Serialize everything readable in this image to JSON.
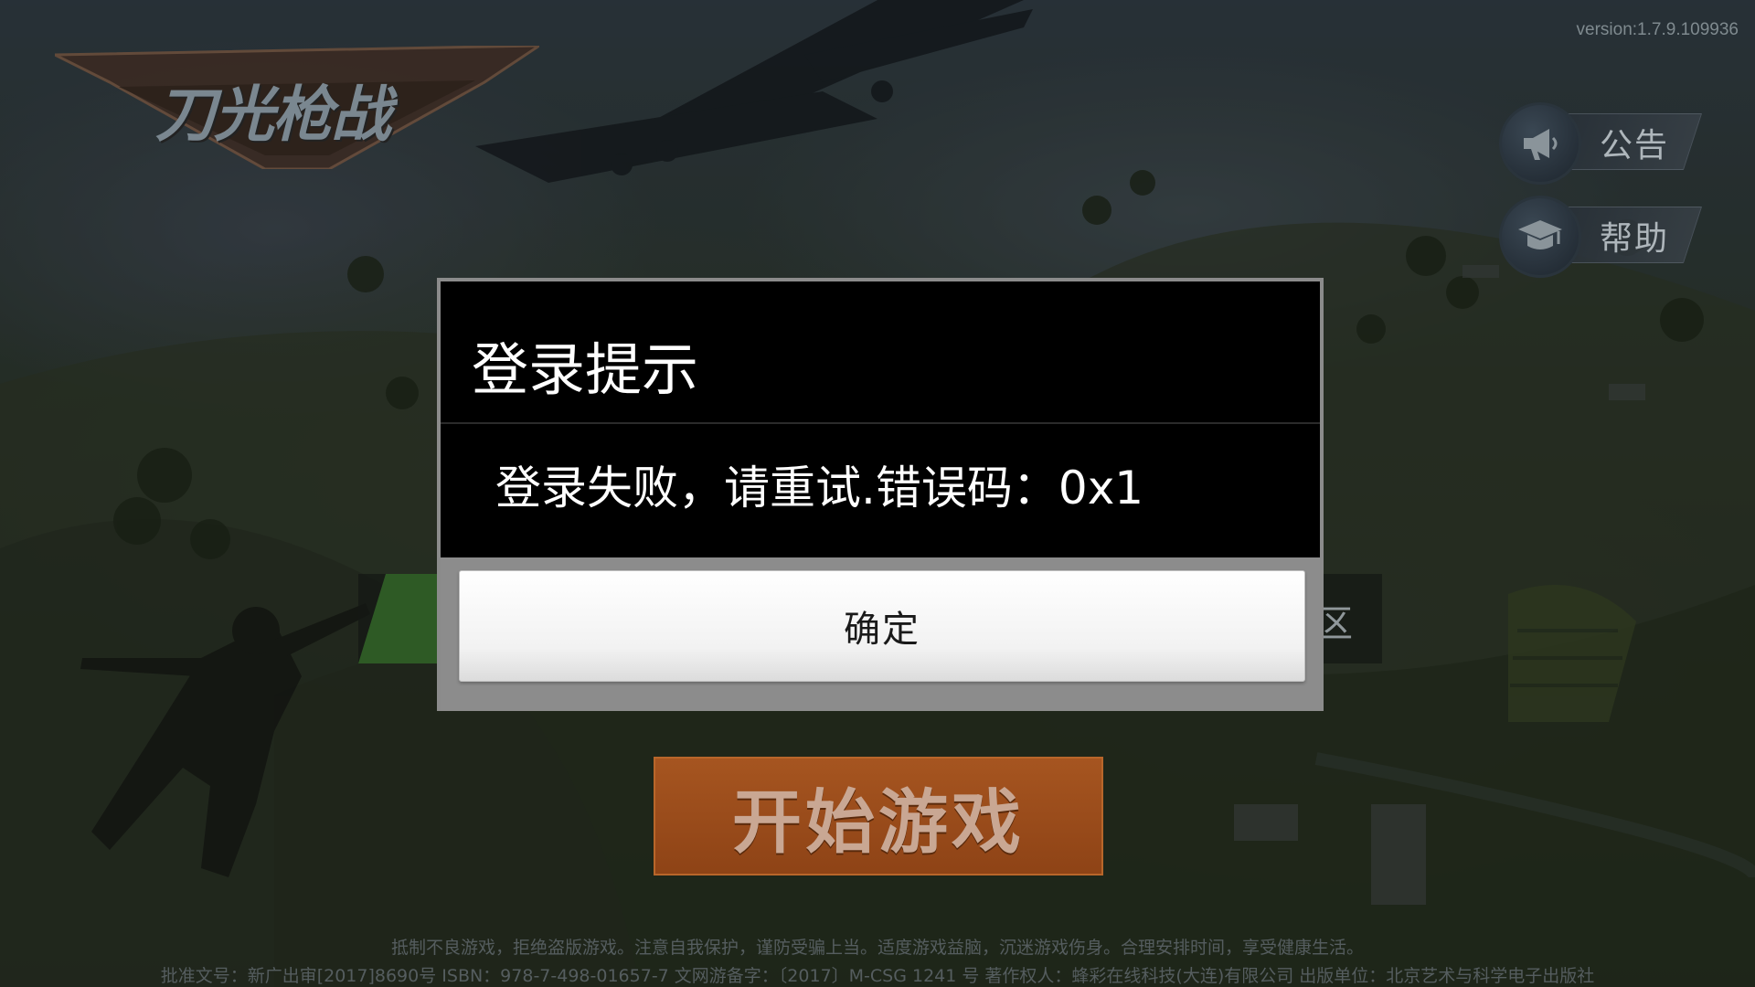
{
  "game": {
    "logo_text": "刀光枪战",
    "version": "version:1.7.9.109936",
    "start_button": "开始游戏",
    "server_tail": "区"
  },
  "side_buttons": [
    {
      "label": "公告",
      "icon": "megaphone-icon"
    },
    {
      "label": "帮助",
      "icon": "graduation-cap-icon"
    }
  ],
  "dialog": {
    "title": "登录提示",
    "message": "登录失败，请重试.错误码：0x1",
    "confirm": "确定"
  },
  "footer": {
    "line1": "抵制不良游戏，拒绝盗版游戏。注意自我保护，谨防受骗上当。适度游戏益脑，沉迷游戏伤身。合理安排时间，享受健康生活。",
    "line2": "批准文号：新广出审[2017]8690号   ISBN：978-7-498-01657-7   文网游备字：〔2017〕M-CSG 1241 号   著作权人：蜂彩在线科技(大连)有限公司   出版单位：北京艺术与科学电子出版社"
  }
}
